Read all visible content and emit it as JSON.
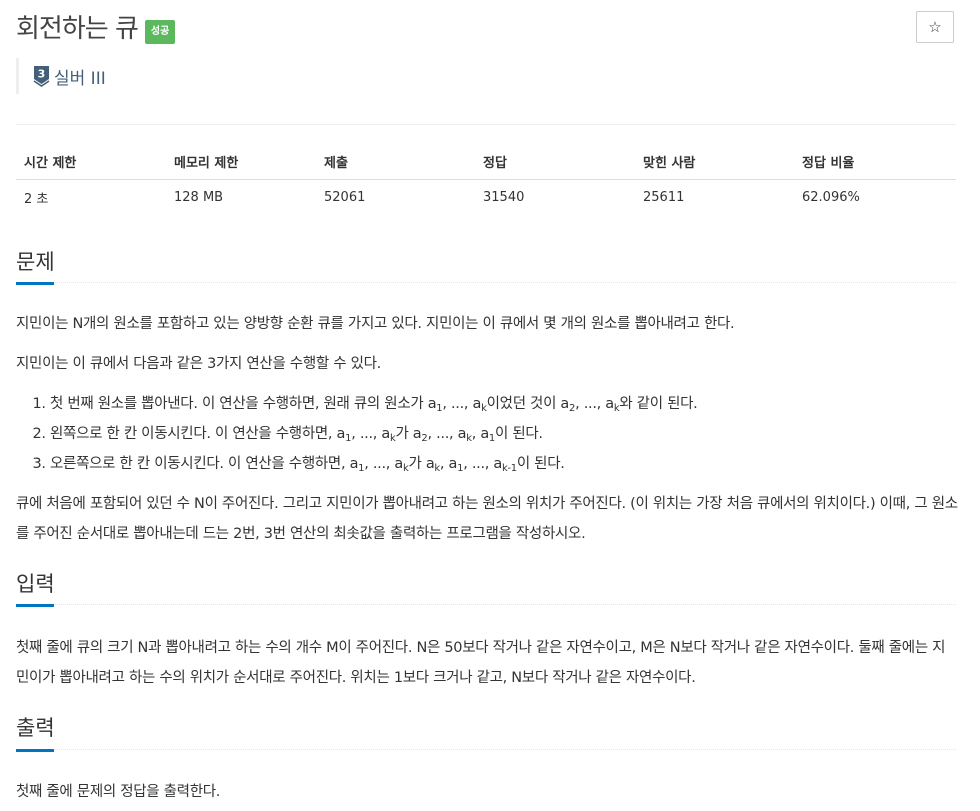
{
  "problem": {
    "title": "회전하는 큐",
    "status_badge": "성공",
    "star_icon": "☆",
    "tier": {
      "icon_number": "3",
      "label": "실버 III",
      "color": "#435f7a"
    }
  },
  "info_table": {
    "headers": [
      "시간 제한",
      "메모리 제한",
      "제출",
      "정답",
      "맞힌 사람",
      "정답 비율"
    ],
    "values": [
      "2 초",
      "128 MB",
      "52061",
      "31540",
      "25611",
      "62.096%"
    ]
  },
  "sections": {
    "problem": {
      "title": "문제",
      "p1": "지민이는 N개의 원소를 포함하고 있는 양방향 순환 큐를 가지고 있다. 지민이는 이 큐에서 몇 개의 원소를 뽑아내려고 한다.",
      "p2": "지민이는 이 큐에서 다음과 같은 3가지 연산을 수행할 수 있다.",
      "op1": {
        "t1": "첫 번째 원소를 뽑아낸다. 이 연산을 수행하면, 원래 큐의 원소가 a",
        "s1": "1",
        "t2": ", ..., a",
        "s2": "k",
        "t3": "이었던 것이 a",
        "s3": "2",
        "t4": ", ..., a",
        "s4": "k",
        "t5": "와 같이 된다."
      },
      "op2": {
        "t1": "왼쪽으로 한 칸 이동시킨다. 이 연산을 수행하면, a",
        "s1": "1",
        "t2": ", ..., a",
        "s2": "k",
        "t3": "가 a",
        "s3": "2",
        "t4": ", ..., a",
        "s4": "k",
        "t5": ", a",
        "s5": "1",
        "t6": "이 된다."
      },
      "op3": {
        "t1": "오른쪽으로 한 칸 이동시킨다. 이 연산을 수행하면, a",
        "s1": "1",
        "t2": ", ..., a",
        "s2": "k",
        "t3": "가 a",
        "s3": "k",
        "t4": ", a",
        "s4": "1",
        "t5": ", ..., a",
        "s5": "k-1",
        "t6": "이 된다."
      },
      "p3": "큐에 처음에 포함되어 있던 수 N이 주어진다. 그리고 지민이가 뽑아내려고 하는 원소의 위치가 주어진다. (이 위치는 가장 처음 큐에서의 위치이다.) 이때, 그 원소를 주어진 순서대로 뽑아내는데 드는 2번, 3번 연산의 최솟값을 출력하는 프로그램을 작성하시오."
    },
    "input": {
      "title": "입력",
      "p1": "첫째 줄에 큐의 크기 N과 뽑아내려고 하는 수의 개수 M이 주어진다. N은 50보다 작거나 같은 자연수이고, M은 N보다 작거나 같은 자연수이다. 둘째 줄에는 지민이가 뽑아내려고 하는 수의 위치가 순서대로 주어진다. 위치는 1보다 크거나 같고, N보다 작거나 같은 자연수이다."
    },
    "output": {
      "title": "출력",
      "p1": "첫째 줄에 문제의 정답을 출력한다."
    }
  }
}
